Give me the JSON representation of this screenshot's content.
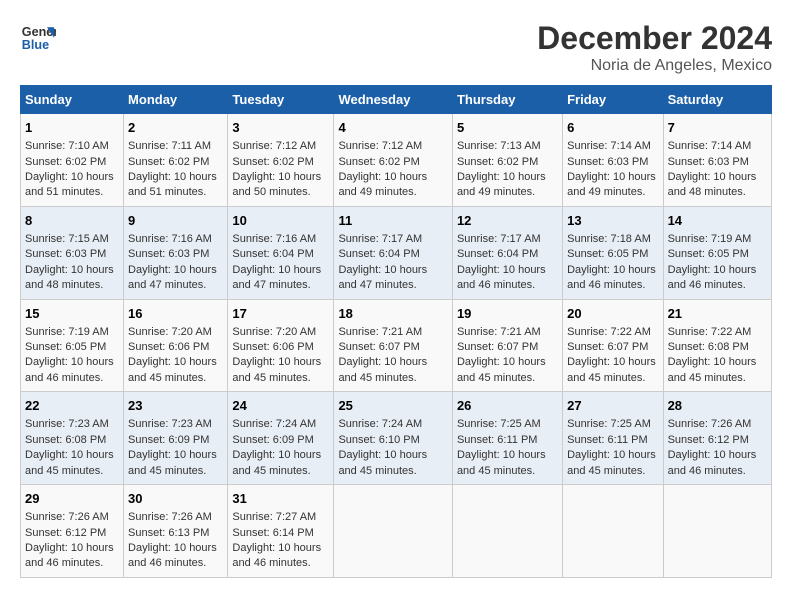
{
  "logo": {
    "line1": "General",
    "line2": "Blue"
  },
  "title": "December 2024",
  "subtitle": "Noria de Angeles, Mexico",
  "days_of_week": [
    "Sunday",
    "Monday",
    "Tuesday",
    "Wednesday",
    "Thursday",
    "Friday",
    "Saturday"
  ],
  "weeks": [
    [
      {
        "day": "1",
        "sunrise": "7:10 AM",
        "sunset": "6:02 PM",
        "daylight": "10 hours and 51 minutes."
      },
      {
        "day": "2",
        "sunrise": "7:11 AM",
        "sunset": "6:02 PM",
        "daylight": "10 hours and 51 minutes."
      },
      {
        "day": "3",
        "sunrise": "7:12 AM",
        "sunset": "6:02 PM",
        "daylight": "10 hours and 50 minutes."
      },
      {
        "day": "4",
        "sunrise": "7:12 AM",
        "sunset": "6:02 PM",
        "daylight": "10 hours and 49 minutes."
      },
      {
        "day": "5",
        "sunrise": "7:13 AM",
        "sunset": "6:02 PM",
        "daylight": "10 hours and 49 minutes."
      },
      {
        "day": "6",
        "sunrise": "7:14 AM",
        "sunset": "6:03 PM",
        "daylight": "10 hours and 49 minutes."
      },
      {
        "day": "7",
        "sunrise": "7:14 AM",
        "sunset": "6:03 PM",
        "daylight": "10 hours and 48 minutes."
      }
    ],
    [
      {
        "day": "8",
        "sunrise": "7:15 AM",
        "sunset": "6:03 PM",
        "daylight": "10 hours and 48 minutes."
      },
      {
        "day": "9",
        "sunrise": "7:16 AM",
        "sunset": "6:03 PM",
        "daylight": "10 hours and 47 minutes."
      },
      {
        "day": "10",
        "sunrise": "7:16 AM",
        "sunset": "6:04 PM",
        "daylight": "10 hours and 47 minutes."
      },
      {
        "day": "11",
        "sunrise": "7:17 AM",
        "sunset": "6:04 PM",
        "daylight": "10 hours and 47 minutes."
      },
      {
        "day": "12",
        "sunrise": "7:17 AM",
        "sunset": "6:04 PM",
        "daylight": "10 hours and 46 minutes."
      },
      {
        "day": "13",
        "sunrise": "7:18 AM",
        "sunset": "6:05 PM",
        "daylight": "10 hours and 46 minutes."
      },
      {
        "day": "14",
        "sunrise": "7:19 AM",
        "sunset": "6:05 PM",
        "daylight": "10 hours and 46 minutes."
      }
    ],
    [
      {
        "day": "15",
        "sunrise": "7:19 AM",
        "sunset": "6:05 PM",
        "daylight": "10 hours and 46 minutes."
      },
      {
        "day": "16",
        "sunrise": "7:20 AM",
        "sunset": "6:06 PM",
        "daylight": "10 hours and 45 minutes."
      },
      {
        "day": "17",
        "sunrise": "7:20 AM",
        "sunset": "6:06 PM",
        "daylight": "10 hours and 45 minutes."
      },
      {
        "day": "18",
        "sunrise": "7:21 AM",
        "sunset": "6:07 PM",
        "daylight": "10 hours and 45 minutes."
      },
      {
        "day": "19",
        "sunrise": "7:21 AM",
        "sunset": "6:07 PM",
        "daylight": "10 hours and 45 minutes."
      },
      {
        "day": "20",
        "sunrise": "7:22 AM",
        "sunset": "6:07 PM",
        "daylight": "10 hours and 45 minutes."
      },
      {
        "day": "21",
        "sunrise": "7:22 AM",
        "sunset": "6:08 PM",
        "daylight": "10 hours and 45 minutes."
      }
    ],
    [
      {
        "day": "22",
        "sunrise": "7:23 AM",
        "sunset": "6:08 PM",
        "daylight": "10 hours and 45 minutes."
      },
      {
        "day": "23",
        "sunrise": "7:23 AM",
        "sunset": "6:09 PM",
        "daylight": "10 hours and 45 minutes."
      },
      {
        "day": "24",
        "sunrise": "7:24 AM",
        "sunset": "6:09 PM",
        "daylight": "10 hours and 45 minutes."
      },
      {
        "day": "25",
        "sunrise": "7:24 AM",
        "sunset": "6:10 PM",
        "daylight": "10 hours and 45 minutes."
      },
      {
        "day": "26",
        "sunrise": "7:25 AM",
        "sunset": "6:11 PM",
        "daylight": "10 hours and 45 minutes."
      },
      {
        "day": "27",
        "sunrise": "7:25 AM",
        "sunset": "6:11 PM",
        "daylight": "10 hours and 45 minutes."
      },
      {
        "day": "28",
        "sunrise": "7:26 AM",
        "sunset": "6:12 PM",
        "daylight": "10 hours and 46 minutes."
      }
    ],
    [
      {
        "day": "29",
        "sunrise": "7:26 AM",
        "sunset": "6:12 PM",
        "daylight": "10 hours and 46 minutes."
      },
      {
        "day": "30",
        "sunrise": "7:26 AM",
        "sunset": "6:13 PM",
        "daylight": "10 hours and 46 minutes."
      },
      {
        "day": "31",
        "sunrise": "7:27 AM",
        "sunset": "6:14 PM",
        "daylight": "10 hours and 46 minutes."
      },
      null,
      null,
      null,
      null
    ]
  ]
}
